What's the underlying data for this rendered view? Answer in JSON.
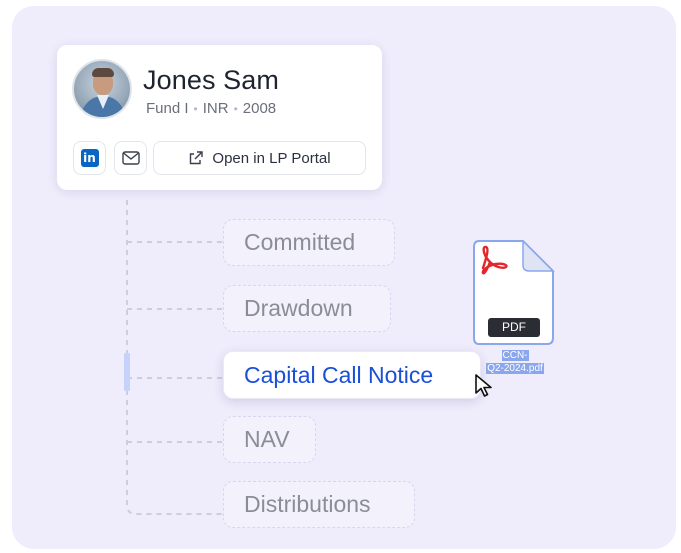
{
  "profile": {
    "name": "Jones Sam",
    "fund": "Fund I",
    "currency": "INR",
    "year": "2008",
    "separator": "•"
  },
  "actions": {
    "linkedin_icon": "linkedin-icon",
    "linkedin_glyph": "in",
    "mail_icon": "mail-icon",
    "portal_label": "Open in LP Portal",
    "portal_icon": "external-link-icon"
  },
  "steps": [
    {
      "label": "Committed",
      "active": false
    },
    {
      "label": "Drawdown",
      "active": false
    },
    {
      "label": "Capital Call Notice",
      "active": true
    },
    {
      "label": "NAV",
      "active": false
    },
    {
      "label": "Distributions",
      "active": false
    }
  ],
  "file": {
    "badge": "PDF",
    "name_line1": "CCN-",
    "name_line2": "Q2-2024.pdf",
    "icon": "acrobat-pdf-icon"
  },
  "colors": {
    "panel_bg": "#efecfb",
    "accent": "#1a4fd6",
    "linkedin": "#0a66c2",
    "pdf_red": "#e3262c",
    "muted_text": "#8a8d97",
    "active_marker": "#c7d2fb"
  }
}
